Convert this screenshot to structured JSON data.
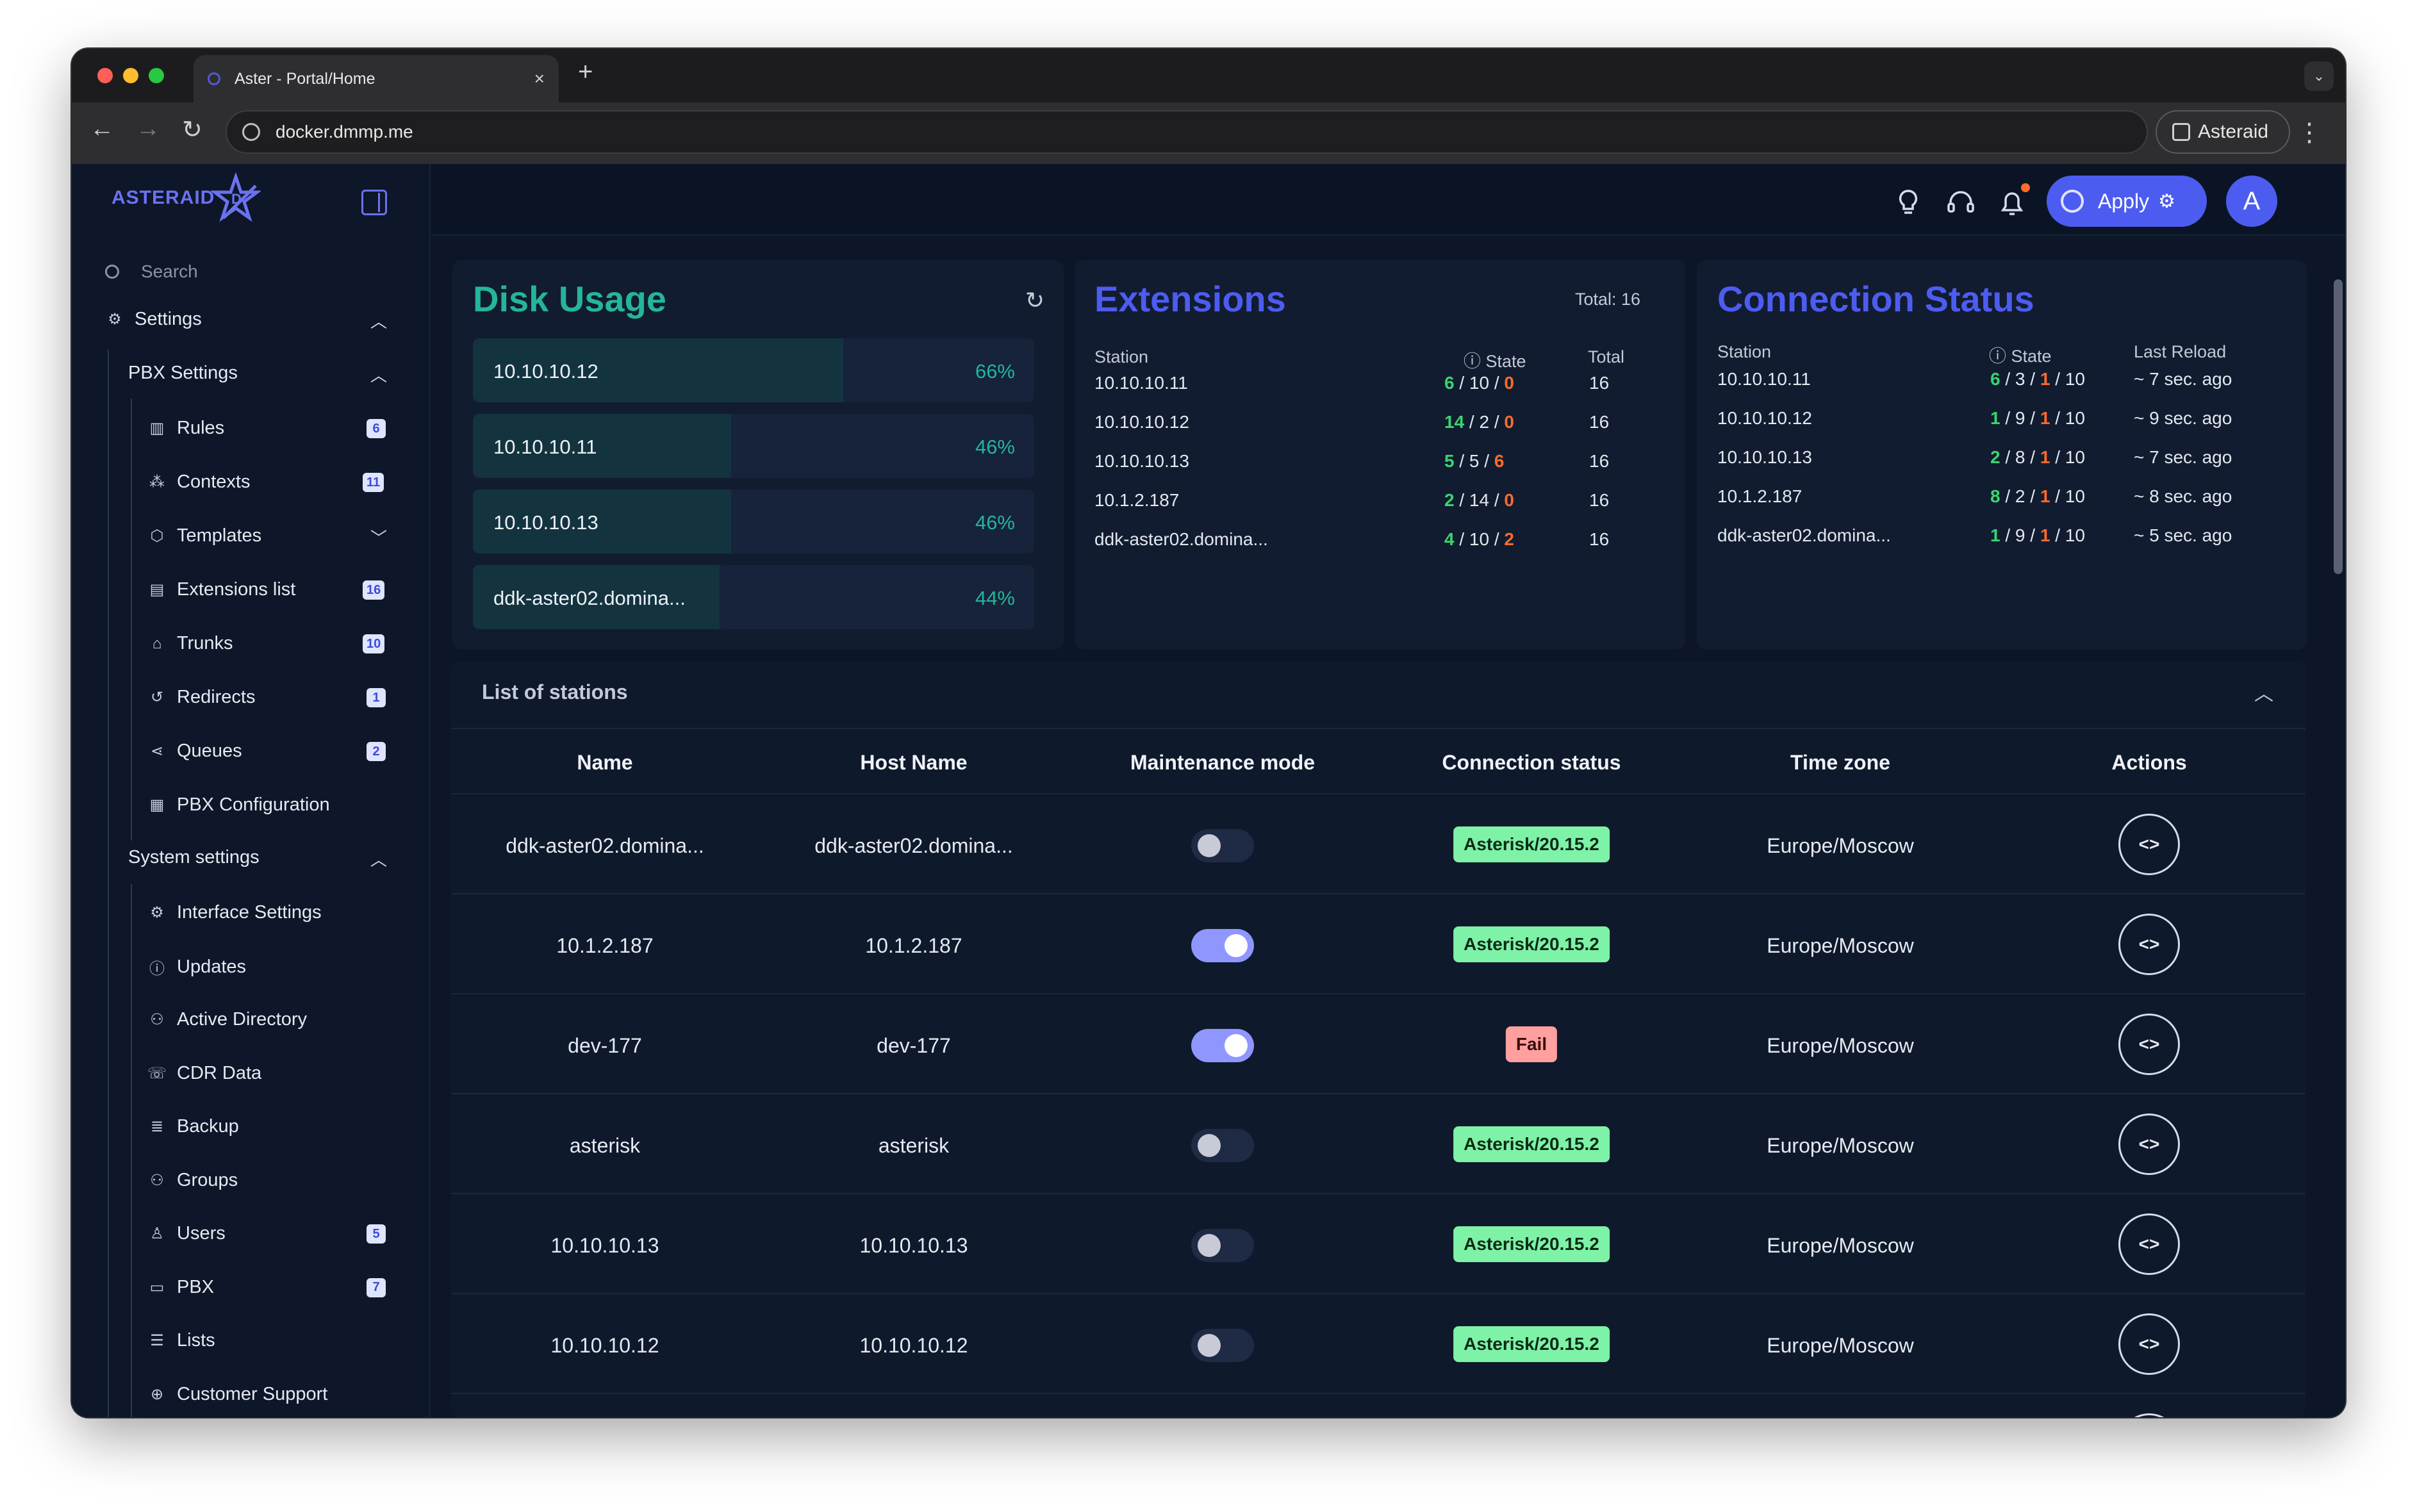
{
  "browser": {
    "tab_title": "Aster - Portal/Home",
    "tab_close": "×",
    "new_tab": "+",
    "url": "docker.dmmp.me",
    "profile": "Asteraid",
    "menu": "⋮",
    "back": "←",
    "forward": "→",
    "reload": "↻",
    "tab_menu": "⌄"
  },
  "sidebar": {
    "logo": "ASTERAID",
    "search_placeholder": "Search",
    "settings": "Settings",
    "pbx_settings": "PBX Settings",
    "pbx_items": [
      {
        "label": "Rules",
        "badge": "6",
        "icon": "bar-chart-icon"
      },
      {
        "label": "Contexts",
        "badge": "11",
        "icon": "sitemap-icon"
      },
      {
        "label": "Templates",
        "badge": "",
        "icon": "cube-icon"
      },
      {
        "label": "Extensions list",
        "badge": "16",
        "icon": "list-box-icon"
      },
      {
        "label": "Trunks",
        "badge": "10",
        "icon": "building-icon"
      },
      {
        "label": "Redirects",
        "badge": "1",
        "icon": "history-icon"
      },
      {
        "label": "Queues",
        "badge": "2",
        "icon": "share-icon"
      },
      {
        "label": "PBX Configuration",
        "badge": "",
        "icon": "document-icon"
      }
    ],
    "system_settings": "System settings",
    "system_items": [
      {
        "label": "Interface Settings",
        "badge": "",
        "icon": "gear-icon"
      },
      {
        "label": "Updates",
        "badge": "",
        "icon": "info-icon"
      },
      {
        "label": "Active Directory",
        "badge": "",
        "icon": "users-icon"
      },
      {
        "label": "CDR Data",
        "badge": "",
        "icon": "phone-icon"
      },
      {
        "label": "Backup",
        "badge": "",
        "icon": "database-icon"
      },
      {
        "label": "Groups",
        "badge": "",
        "icon": "group-icon"
      },
      {
        "label": "Users",
        "badge": "5",
        "icon": "user-icon"
      },
      {
        "label": "PBX",
        "badge": "7",
        "icon": "monitor-icon"
      },
      {
        "label": "Lists",
        "badge": "",
        "icon": "list-icon"
      },
      {
        "label": "Customer Support",
        "badge": "",
        "icon": "globe-icon"
      }
    ]
  },
  "header": {
    "apply_label": "Apply",
    "avatar_letter": "A"
  },
  "disk_usage": {
    "title": "Disk Usage",
    "title_color": "#25b59a",
    "rows": [
      {
        "name": "10.10.10.12",
        "percent_label": "66%",
        "percent": 66
      },
      {
        "name": "10.10.10.11",
        "percent_label": "46%",
        "percent": 46
      },
      {
        "name": "10.10.10.13",
        "percent_label": "46%",
        "percent": 46
      },
      {
        "name": "ddk-aster02.domina...",
        "percent_label": "44%",
        "percent": 44
      }
    ]
  },
  "extensions": {
    "title": "Extensions",
    "total_label": "Total: 16",
    "col_station": "Station",
    "col_state": "State",
    "col_total": "Total",
    "rows": [
      {
        "station": "10.10.10.11",
        "a": "6",
        "b": "10",
        "c": "0",
        "total": "16"
      },
      {
        "station": "10.10.10.12",
        "a": "14",
        "b": "2",
        "c": "0",
        "total": "16"
      },
      {
        "station": "10.10.10.13",
        "a": "5",
        "b": "5",
        "c": "6",
        "total": "16"
      },
      {
        "station": "10.1.2.187",
        "a": "2",
        "b": "14",
        "c": "0",
        "total": "16"
      },
      {
        "station": "ddk-aster02.domina...",
        "a": "4",
        "b": "10",
        "c": "2",
        "total": "16"
      }
    ]
  },
  "connection_status": {
    "title": "Connection Status",
    "col_station": "Station",
    "col_state": "State",
    "col_reload": "Last Reload",
    "rows": [
      {
        "station": "10.10.10.11",
        "a": "6",
        "b": "3",
        "c": "1",
        "d": "10",
        "reload": "~ 7 sec. ago"
      },
      {
        "station": "10.10.10.12",
        "a": "1",
        "b": "9",
        "c": "1",
        "d": "10",
        "reload": "~ 9 sec. ago"
      },
      {
        "station": "10.10.10.13",
        "a": "2",
        "b": "8",
        "c": "1",
        "d": "10",
        "reload": "~ 7 sec. ago"
      },
      {
        "station": "10.1.2.187",
        "a": "8",
        "b": "2",
        "c": "1",
        "d": "10",
        "reload": "~ 8 sec. ago"
      },
      {
        "station": "ddk-aster02.domina...",
        "a": "1",
        "b": "9",
        "c": "1",
        "d": "10",
        "reload": "~ 5 sec. ago"
      }
    ]
  },
  "stations": {
    "title": "List of stations",
    "columns": [
      "Name",
      "Host Name",
      "Maintenance mode",
      "Connection status",
      "Time zone",
      "Actions"
    ],
    "rows": [
      {
        "name": "ddk-aster02.domina...",
        "host": "ddk-aster02.domina...",
        "maintenance": false,
        "status": "Asterisk/20.15.2",
        "status_ok": true,
        "tz": "Europe/Moscow"
      },
      {
        "name": "10.1.2.187",
        "host": "10.1.2.187",
        "maintenance": true,
        "status": "Asterisk/20.15.2",
        "status_ok": true,
        "tz": "Europe/Moscow"
      },
      {
        "name": "dev-177",
        "host": "dev-177",
        "maintenance": true,
        "status": "Fail",
        "status_ok": false,
        "tz": "Europe/Moscow"
      },
      {
        "name": "asterisk",
        "host": "asterisk",
        "maintenance": false,
        "status": "Asterisk/20.15.2",
        "status_ok": true,
        "tz": "Europe/Moscow"
      },
      {
        "name": "10.10.10.13",
        "host": "10.10.10.13",
        "maintenance": false,
        "status": "Asterisk/20.15.2",
        "status_ok": true,
        "tz": "Europe/Moscow"
      },
      {
        "name": "10.10.10.12",
        "host": "10.10.10.12",
        "maintenance": false,
        "status": "Asterisk/20.15.2",
        "status_ok": true,
        "tz": "Europe/Moscow"
      }
    ]
  },
  "colors": {
    "accent": "#4d5cf0",
    "green": "#39d56e",
    "orange": "#ff6a2a",
    "background": "#0c1628"
  }
}
